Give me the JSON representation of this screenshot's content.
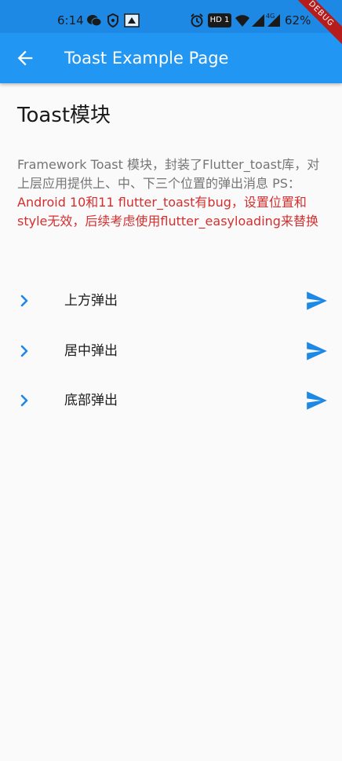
{
  "status_bar": {
    "time": "6:14",
    "network_badge": "HD 1",
    "signal_label": "4G",
    "battery": "62%"
  },
  "debug_banner": "DEBUG",
  "app_bar": {
    "title": "Toast Example Page",
    "back_icon": "arrow-back-icon"
  },
  "page": {
    "heading": "Toast模块",
    "description": "Framework Toast 模块，封装了Flutter_toast库，对上层应用提供上、中、下三个位置的弹出消息  PS：",
    "description_note": "Android 10和11 flutter_toast有bug，设置位置和style无效，后续考虑使用flutter_easyloading来替换",
    "items": [
      {
        "label": "上方弹出"
      },
      {
        "label": "居中弹出"
      },
      {
        "label": "底部弹出"
      }
    ]
  },
  "colors": {
    "primary": "#2196f3",
    "status_bar": "#1e88e5",
    "accent_icon": "#1e88e5",
    "note_red": "#d32f2f",
    "description_gray": "#757575",
    "background": "#fafafa"
  }
}
